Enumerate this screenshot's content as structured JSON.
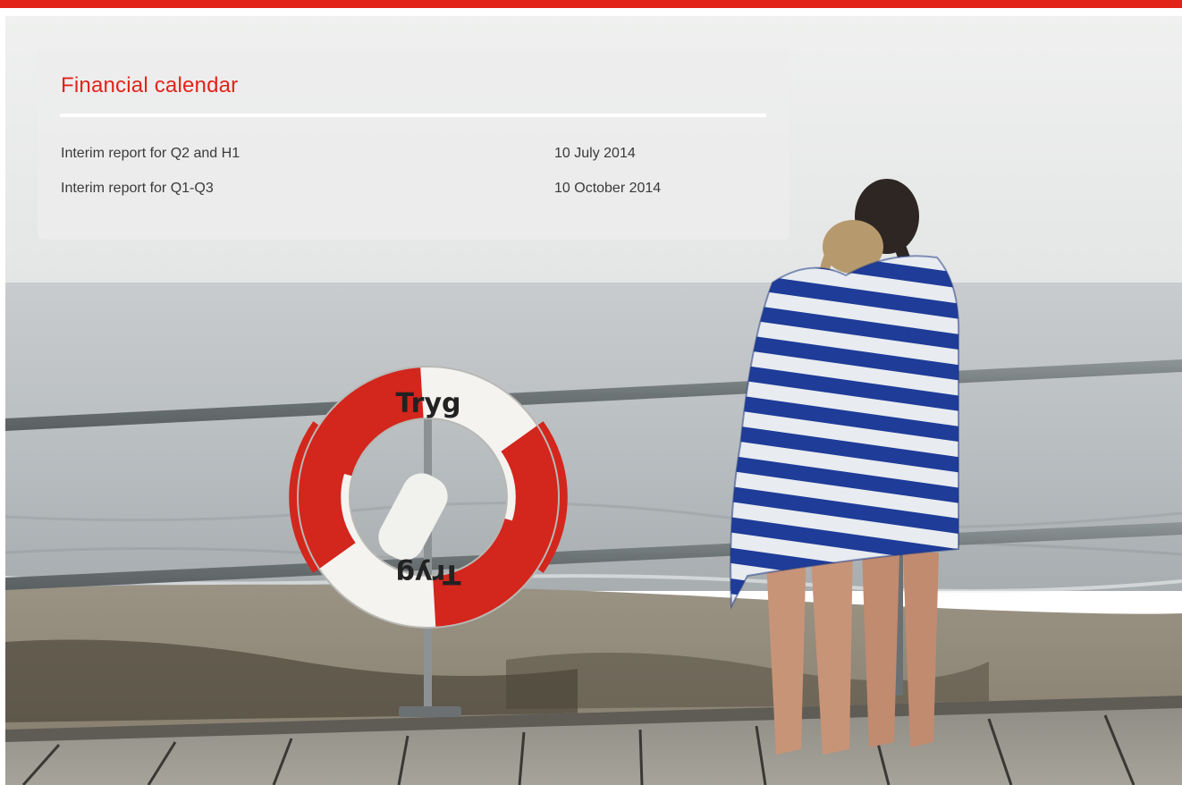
{
  "calendar": {
    "title": "Financial calendar",
    "events": [
      {
        "label": "Interim report for Q2 and H1",
        "date": "10 July 2014"
      },
      {
        "label": "Interim report for Q1-Q3",
        "date": "10 October 2014"
      }
    ]
  },
  "photo": {
    "lifebuoy_text": "Tryg"
  },
  "colors": {
    "accent": "#e2231a",
    "text": "#3a3a3a",
    "towel_blue": "#1f3f9a"
  }
}
